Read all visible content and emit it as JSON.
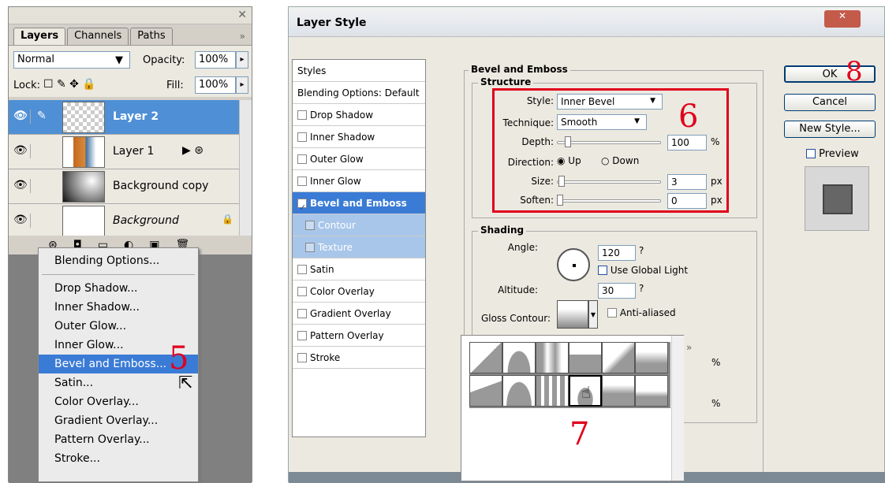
{
  "layers_panel": {
    "tabs": [
      "Layers",
      "Channels",
      "Paths"
    ],
    "blend_mode": "Normal",
    "opacity_label": "Opacity:",
    "opacity_value": "100%",
    "lock_label": "Lock:",
    "fill_label": "Fill:",
    "fill_value": "100%",
    "layers": [
      "Layer 2",
      "Layer 1",
      "Background copy",
      "Background"
    ]
  },
  "menu": {
    "items": [
      "Blending Options...",
      "Drop Shadow...",
      "Inner Shadow...",
      "Outer Glow...",
      "Inner Glow...",
      "Bevel and Emboss...",
      "Satin...",
      "Color Overlay...",
      "Gradient Overlay...",
      "Pattern Overlay...",
      "Stroke..."
    ],
    "highlighted": 5
  },
  "steps": {
    "s5": "5",
    "s6": "6",
    "s7": "7",
    "s8": "8"
  },
  "dialog": {
    "title": "Layer Style",
    "styles_header": "Styles",
    "blending": "Blending Options: Default",
    "items": [
      "Drop Shadow",
      "Inner Shadow",
      "Outer Glow",
      "Inner Glow",
      "Bevel and Emboss",
      "Contour",
      "Texture",
      "Satin",
      "Color Overlay",
      "Gradient Overlay",
      "Pattern Overlay",
      "Stroke"
    ],
    "section": "Bevel and Emboss",
    "structure": "Structure",
    "style_label": "Style:",
    "style_value": "Inner Bevel",
    "technique_label": "Technique:",
    "technique_value": "Smooth",
    "depth_label": "Depth:",
    "depth_value": "100",
    "pct": "%",
    "direction_label": "Direction:",
    "up": "Up",
    "down": "Down",
    "size_label": "Size:",
    "size_value": "3",
    "px": "px",
    "soften_label": "Soften:",
    "soften_value": "0",
    "shading": "Shading",
    "angle_label": "Angle:",
    "angle_value": "120",
    "deg": "?",
    "global_light": "Use Global Light",
    "altitude_label": "Altitude:",
    "altitude_value": "30",
    "gloss_label": "Gloss Contour:",
    "anti_aliased": "Anti-aliased",
    "ok": "OK",
    "cancel": "Cancel",
    "new_style": "New Style...",
    "preview": "Preview"
  },
  "colors": {
    "accent": "#3a7bd5",
    "red": "#e0001c"
  }
}
